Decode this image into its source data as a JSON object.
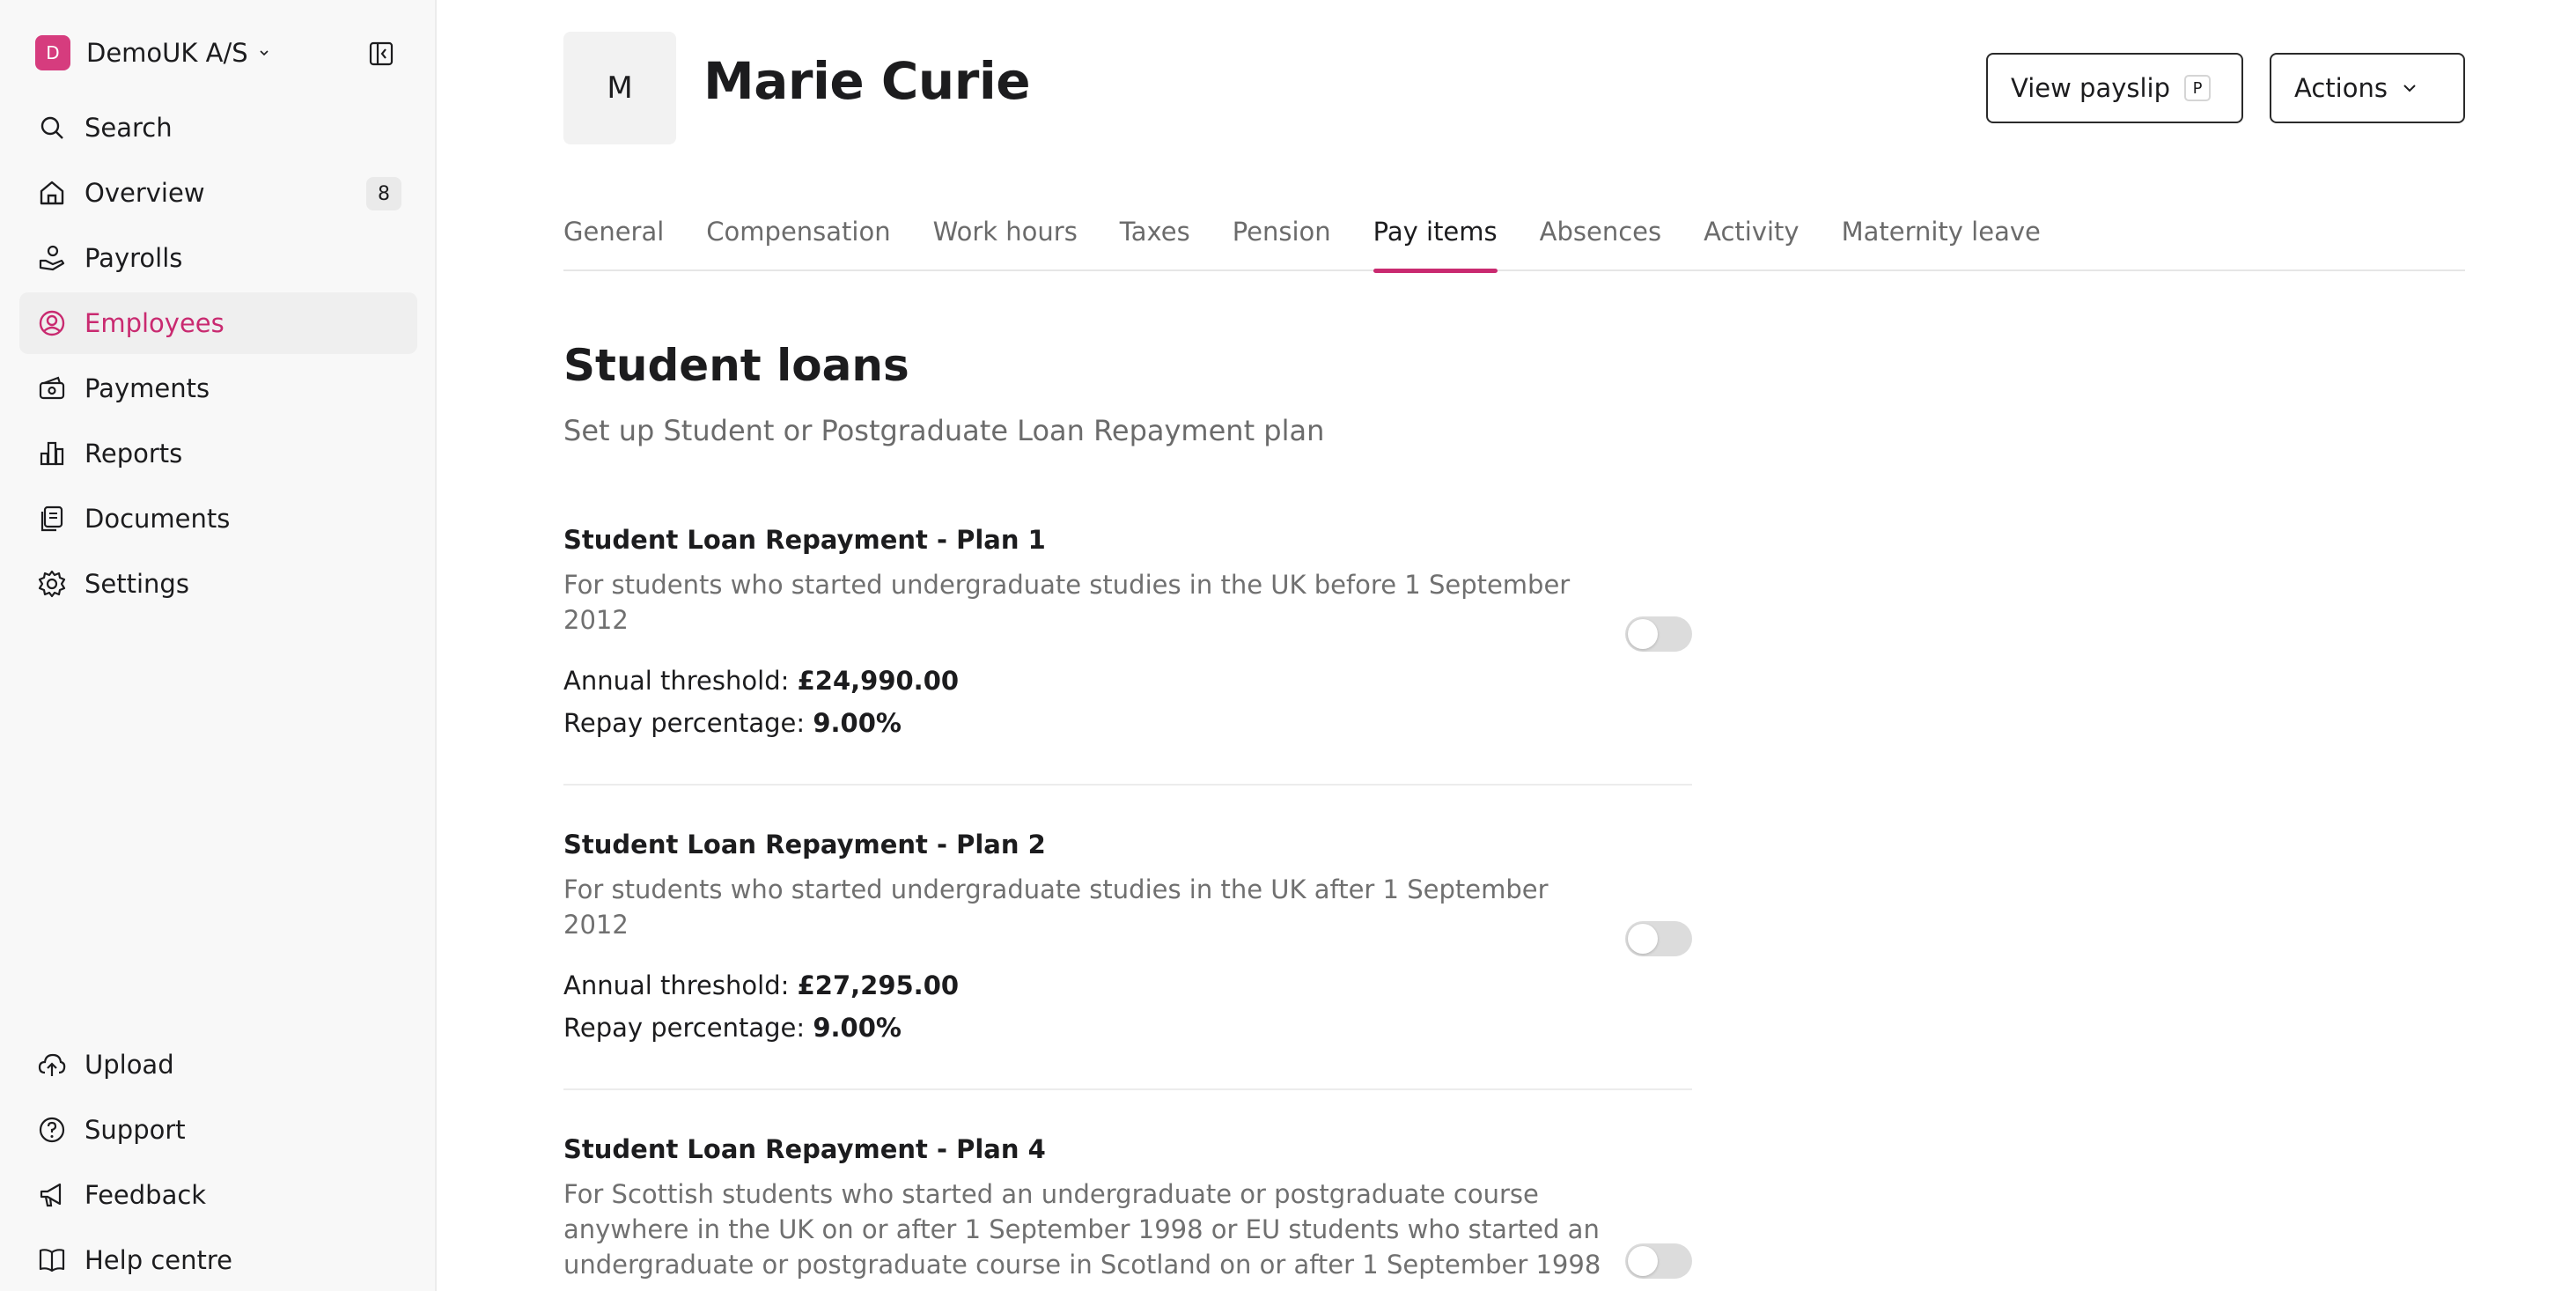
{
  "sidebar": {
    "org_initial": "D",
    "org_name": "DemoUK A/S",
    "items": [
      {
        "label": "Search",
        "icon": "search-icon"
      },
      {
        "label": "Overview",
        "icon": "home-icon",
        "badge": "8"
      },
      {
        "label": "Payrolls",
        "icon": "payroll-hand-icon"
      },
      {
        "label": "Employees",
        "icon": "user-circle-icon",
        "active": true
      },
      {
        "label": "Payments",
        "icon": "payments-icon"
      },
      {
        "label": "Reports",
        "icon": "bar-chart-icon"
      },
      {
        "label": "Documents",
        "icon": "documents-icon"
      },
      {
        "label": "Settings",
        "icon": "gear-icon"
      }
    ],
    "bottom_items": [
      {
        "label": "Upload",
        "icon": "cloud-upload-icon"
      },
      {
        "label": "Support",
        "icon": "help-circle-icon"
      },
      {
        "label": "Feedback",
        "icon": "megaphone-icon"
      },
      {
        "label": "Help centre",
        "icon": "book-icon"
      }
    ],
    "accent_color": "#c92a70"
  },
  "employee": {
    "initial": "M",
    "name": "Marie Curie"
  },
  "header": {
    "view_payslip_label": "View payslip",
    "view_payslip_shortcut": "P",
    "actions_label": "Actions"
  },
  "tabs": [
    {
      "label": "General"
    },
    {
      "label": "Compensation"
    },
    {
      "label": "Work hours"
    },
    {
      "label": "Taxes"
    },
    {
      "label": "Pension"
    },
    {
      "label": "Pay items",
      "active": true
    },
    {
      "label": "Absences"
    },
    {
      "label": "Activity"
    },
    {
      "label": "Maternity leave"
    }
  ],
  "section": {
    "title": "Student loans",
    "subtitle": "Set up Student or Postgraduate Loan Repayment plan"
  },
  "plans": [
    {
      "title": "Student Loan Repayment - Plan 1",
      "description": "For students who started undergraduate studies in the UK before 1 September 2012",
      "threshold_label": "Annual threshold:",
      "threshold_value": "£24,990.00",
      "repay_label": "Repay percentage:",
      "repay_value": "9.00%",
      "enabled": false
    },
    {
      "title": "Student Loan Repayment - Plan 2",
      "description": "For students who started undergraduate studies in the UK after 1 September 2012",
      "threshold_label": "Annual threshold:",
      "threshold_value": "£27,295.00",
      "repay_label": "Repay percentage:",
      "repay_value": "9.00%",
      "enabled": false
    },
    {
      "title": "Student Loan Repayment - Plan 4",
      "description": "For Scottish students who started an undergraduate or postgraduate course anywhere in the UK on or after 1 September 1998 or EU students who started an undergraduate or postgraduate course in Scotland on or after 1 September 1998",
      "enabled": false
    }
  ]
}
